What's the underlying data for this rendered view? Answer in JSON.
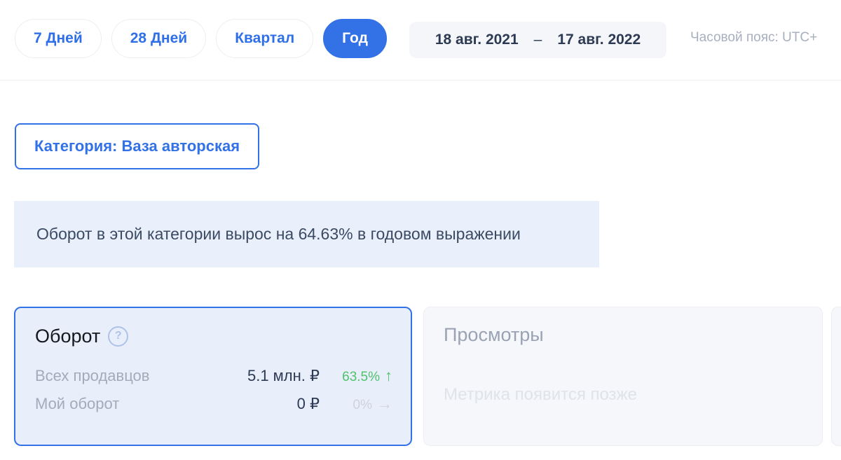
{
  "toolbar": {
    "periods": [
      {
        "label": "7 Дней",
        "active": false
      },
      {
        "label": "28 Дней",
        "active": false
      },
      {
        "label": "Квартал",
        "active": false
      },
      {
        "label": "Год",
        "active": true
      }
    ],
    "daterange": {
      "start": "18 авг. 2021",
      "separator": "–",
      "end": "17 авг. 2022"
    },
    "timezone": "Часовой пояс: UTC+"
  },
  "category_chip": {
    "label": "Категория: Ваза авторская"
  },
  "info_banner": {
    "text": "Оборот в этой категории вырос на 64.63% в годовом выражении"
  },
  "cards": [
    {
      "title": "Оборот",
      "help_icon": "?",
      "rows": [
        {
          "label": "Всех продавцов",
          "value": "5.1 млн. ₽",
          "delta": "63.5%",
          "arrow": "↑",
          "trend": "up"
        },
        {
          "label": "Мой оборот",
          "value": "0 ₽",
          "delta": "0%",
          "arrow": "→",
          "trend": "flat"
        }
      ]
    },
    {
      "title": "Просмотры",
      "placeholder": "Метрика появится позже"
    }
  ],
  "colors": {
    "accent": "#3271e6",
    "active_card_bg": "#e9eefb",
    "banner_bg": "#e9f0fb",
    "muted_card_bg": "#f6f7fa",
    "positive": "#4fc26b",
    "text_primary": "#2d3a53",
    "text_muted": "#a3abbb"
  }
}
